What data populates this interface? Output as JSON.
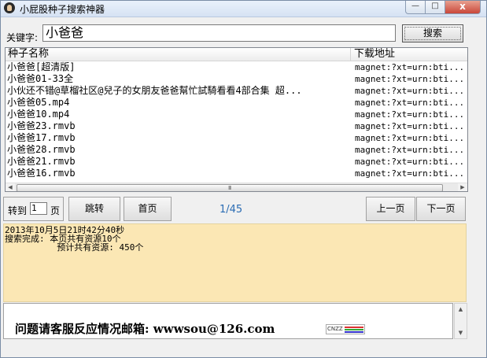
{
  "window": {
    "title": "小屁股种子搜索神器",
    "minimize_label": "—",
    "maximize_label": "□",
    "close_label": "x"
  },
  "search": {
    "label": "关键字:",
    "value": "小爸爸",
    "button_label": "搜索"
  },
  "results": {
    "columns": [
      "种子名称",
      "下载地址"
    ],
    "rows": [
      {
        "name": "小爸爸[超清版]",
        "link": "magnet:?xt=urn:bti..."
      },
      {
        "name": "小爸爸01-33全",
        "link": "magnet:?xt=urn:bti..."
      },
      {
        "name": "小伙还不错@草榴社区@兒子的女朋友爸爸幫忙試騎看看4部合集 超...",
        "link": "magnet:?xt=urn:bti..."
      },
      {
        "name": "小爸爸05.mp4",
        "link": "magnet:?xt=urn:bti..."
      },
      {
        "name": "小爸爸10.mp4",
        "link": "magnet:?xt=urn:bti..."
      },
      {
        "name": "小爸爸23.rmvb",
        "link": "magnet:?xt=urn:bti..."
      },
      {
        "name": "小爸爸17.rmvb",
        "link": "magnet:?xt=urn:bti..."
      },
      {
        "name": "小爸爸28.rmvb",
        "link": "magnet:?xt=urn:bti..."
      },
      {
        "name": "小爸爸21.rmvb",
        "link": "magnet:?xt=urn:bti..."
      },
      {
        "name": "小爸爸16.rmvb",
        "link": "magnet:?xt=urn:bti..."
      }
    ],
    "scroll_grip": "III"
  },
  "pager": {
    "goto_prefix": "转到",
    "goto_value": "1",
    "goto_suffix": "页",
    "jump_label": "跳转",
    "first_label": "首页",
    "page_indicator": "1/45",
    "prev_label": "上一页",
    "next_label": "下一页"
  },
  "log": {
    "lines": [
      "2013年10月5日21时42分40秒",
      "搜索完成: 本页共有资源10个",
      "          预计共有资源: 450个"
    ]
  },
  "notice": {
    "text": "问题请客服反应情况邮箱: wwwsou@126.com",
    "badge_label": "CNZZ"
  }
}
